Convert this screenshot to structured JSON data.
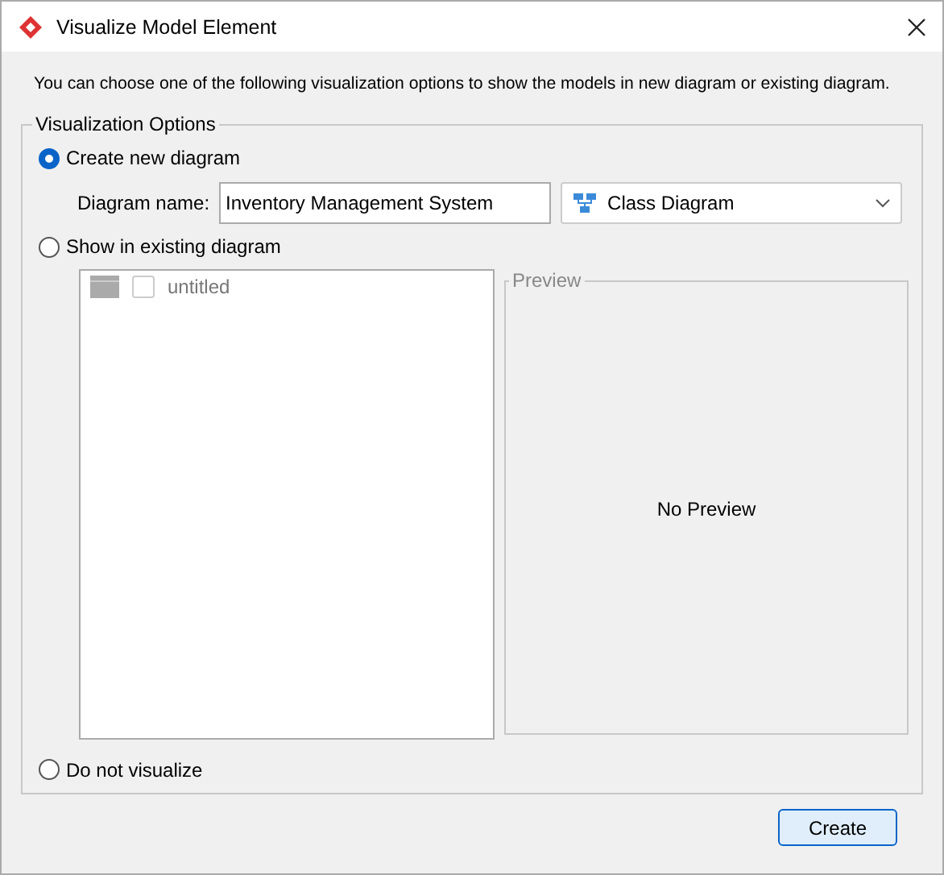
{
  "window": {
    "title": "Visualize Model Element"
  },
  "intro": "You can choose one of the following visualization options to show the models in new diagram or existing diagram.",
  "group": {
    "title": "Visualization Options"
  },
  "options": [
    {
      "kind": "new",
      "label": "Create new diagram",
      "selected": true
    },
    {
      "kind": "existing",
      "label": "Show in existing diagram",
      "selected": false
    },
    {
      "kind": "none",
      "label": "Do not visualize",
      "selected": false
    }
  ],
  "diagram_name": {
    "label": "Diagram name:",
    "value": "Inventory Management System"
  },
  "diagram_type": {
    "value": "Class Diagram"
  },
  "diagrams": [
    {
      "label": "untitled",
      "checked": false
    }
  ],
  "preview": {
    "title": "Preview",
    "message": "No Preview"
  },
  "buttons": [
    {
      "label": "Create"
    }
  ]
}
